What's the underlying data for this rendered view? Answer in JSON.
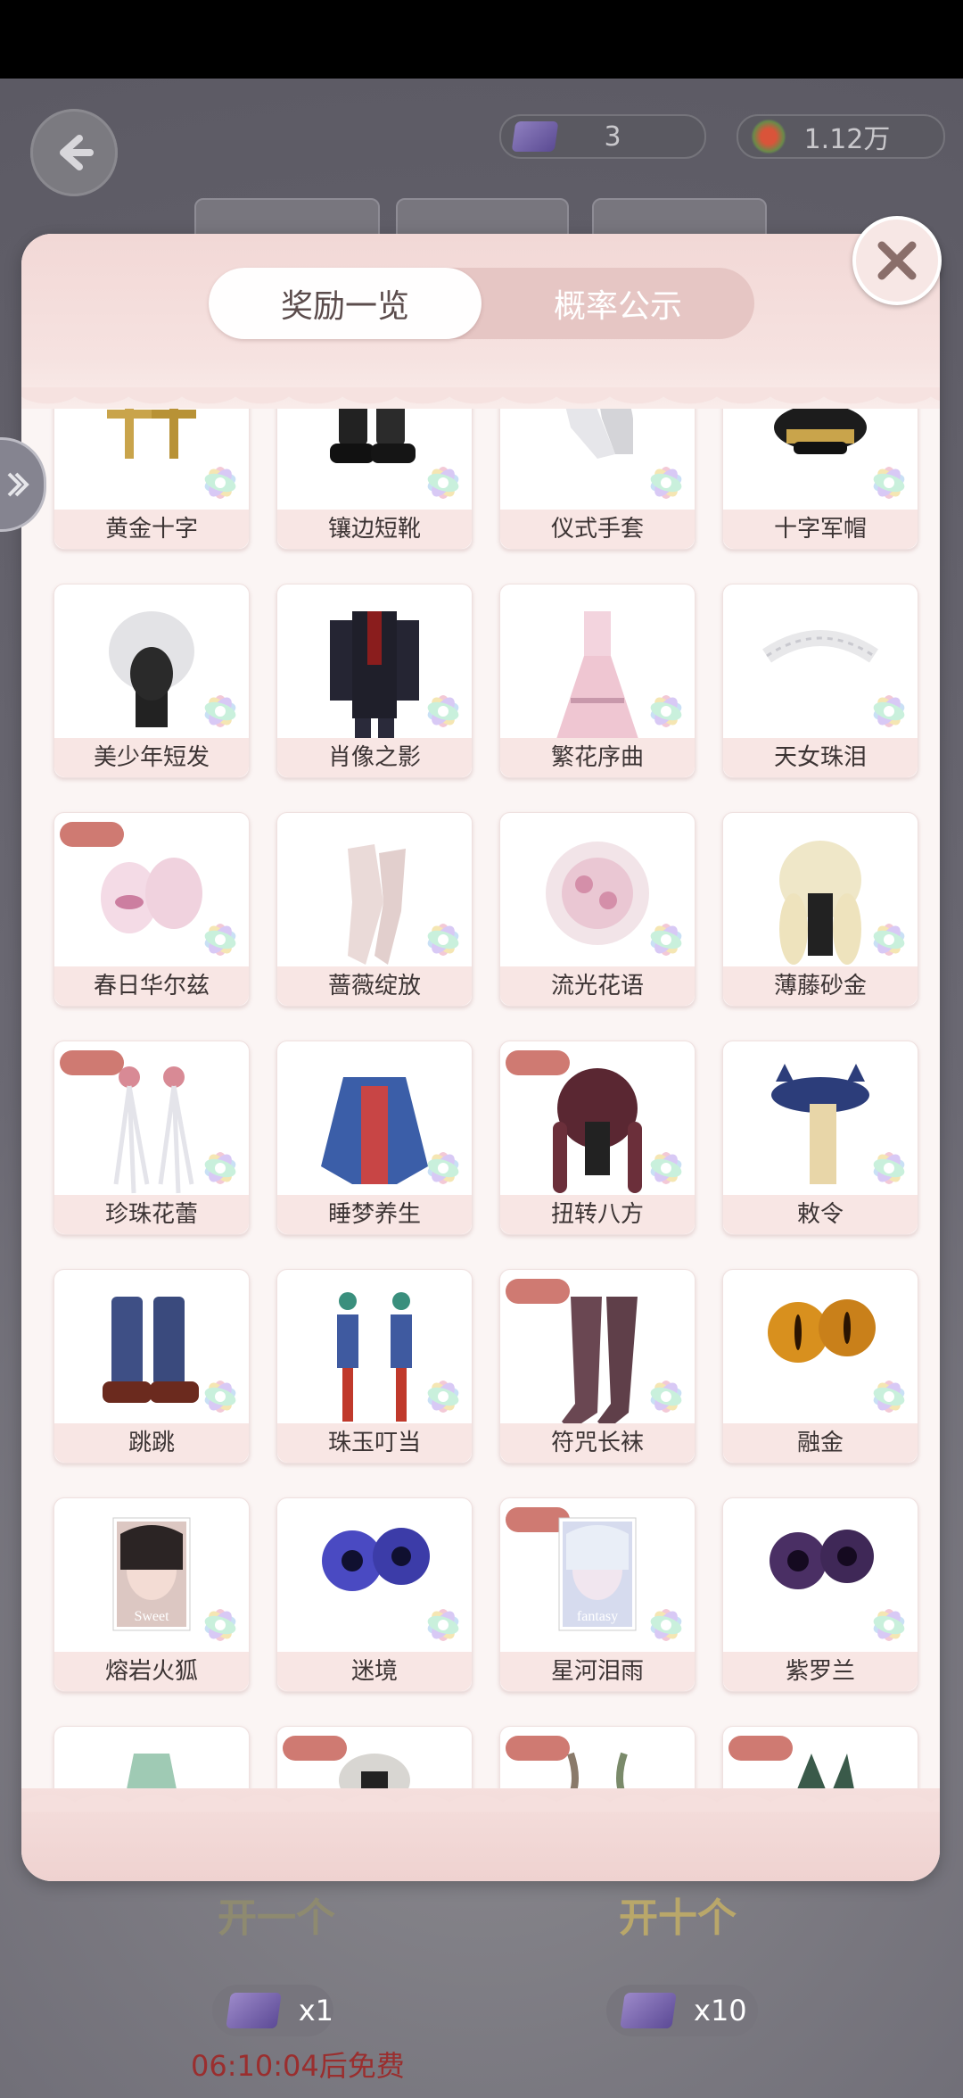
{
  "top": {
    "tickets": "3",
    "currency": "1.12万"
  },
  "tabs": {
    "rewards": "奖励一览",
    "probability": "概率公示"
  },
  "items": [
    {
      "name": "黄金十字",
      "badge": false,
      "icon": "gold-cross-earrings-icon"
    },
    {
      "name": "镶边短靴",
      "badge": false,
      "icon": "boots-icon"
    },
    {
      "name": "仪式手套",
      "badge": false,
      "icon": "gloves-icon"
    },
    {
      "name": "十字军帽",
      "badge": false,
      "icon": "military-cap-icon"
    },
    {
      "name": "美少年短发",
      "badge": false,
      "icon": "white-short-hair-icon"
    },
    {
      "name": "肖像之影",
      "badge": false,
      "icon": "coat-outfit-icon"
    },
    {
      "name": "繁花序曲",
      "badge": false,
      "icon": "pink-dress-icon"
    },
    {
      "name": "天女珠泪",
      "badge": false,
      "icon": "pearl-tiara-icon"
    },
    {
      "name": "春日华尔兹",
      "badge": true,
      "icon": "pink-shoes-icon"
    },
    {
      "name": "蔷薇绽放",
      "badge": false,
      "icon": "lace-gloves-icon"
    },
    {
      "name": "流光花语",
      "badge": false,
      "icon": "floral-headpiece-icon"
    },
    {
      "name": "薄藤砂金",
      "badge": false,
      "icon": "blonde-curly-hair-icon"
    },
    {
      "name": "珍珠花蕾",
      "badge": true,
      "icon": "pearl-earrings-icon"
    },
    {
      "name": "睡梦养生",
      "badge": false,
      "icon": "blue-jacket-icon"
    },
    {
      "name": "扭转八方",
      "badge": true,
      "icon": "braided-hair-icon"
    },
    {
      "name": "敕令",
      "badge": false,
      "icon": "cat-ear-hat-icon"
    },
    {
      "name": "跳跳",
      "badge": false,
      "icon": "blue-boots-icon"
    },
    {
      "name": "珠玉叮当",
      "badge": false,
      "icon": "tassel-earrings-icon"
    },
    {
      "name": "符咒长袜",
      "badge": true,
      "icon": "long-socks-icon"
    },
    {
      "name": "融金",
      "badge": false,
      "icon": "gold-eyes-icon"
    },
    {
      "name": "熔岩火狐",
      "badge": false,
      "icon": "makeup-card-icon"
    },
    {
      "name": "迷境",
      "badge": false,
      "icon": "blue-eyes-icon"
    },
    {
      "name": "星河泪雨",
      "badge": true,
      "icon": "makeup-card-fantasy-icon"
    },
    {
      "name": "紫罗兰",
      "badge": false,
      "icon": "purple-eyes-icon"
    },
    {
      "name": "",
      "badge": false,
      "icon": "green-dress-icon"
    },
    {
      "name": "",
      "badge": true,
      "icon": "masked-hair-icon"
    },
    {
      "name": "",
      "badge": true,
      "icon": "horns-icon"
    },
    {
      "name": "",
      "badge": true,
      "icon": "dark-accessory-icon"
    }
  ],
  "card_texts": {
    "sweet": "Sweet",
    "fantasy": "fantasy"
  },
  "actions": {
    "open_one": "开一个",
    "open_ten": "开十个",
    "cost_one": "x1",
    "cost_ten": "x10",
    "free_timer": "06:10:04后免费"
  },
  "colors": {
    "badge": "#cf7a72",
    "label_bg": "#f8e6e4",
    "tab_bg": "#e6c6c4",
    "timer": "#9a2e2e"
  }
}
